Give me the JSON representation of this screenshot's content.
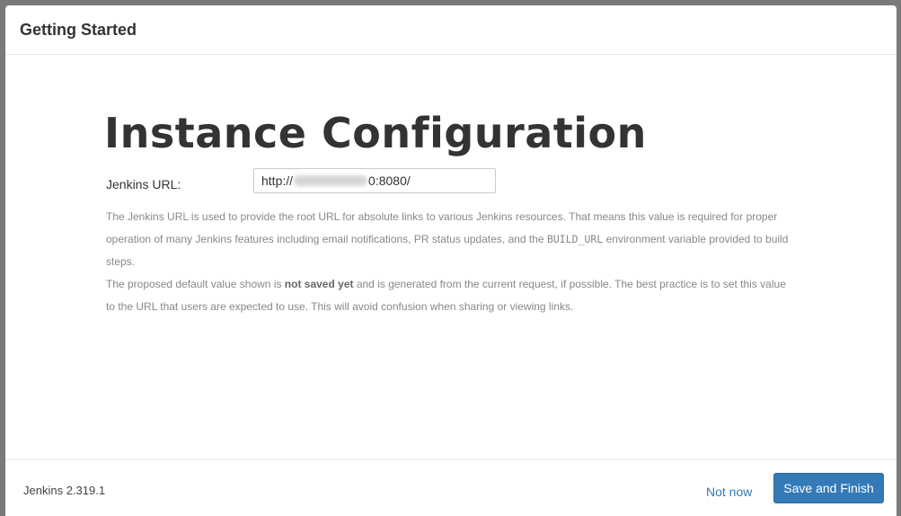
{
  "header": {
    "title": "Getting Started"
  },
  "main": {
    "title": "Instance Configuration",
    "url_label": "Jenkins URL:",
    "url_prefix": "http://",
    "url_suffix": "0:8080/",
    "help_line1": "The Jenkins URL is used to provide the root URL for absolute links to various Jenkins resources. That means this value is required for proper operation of many Jenkins features including email notifications, PR status updates, and the ",
    "help_code": "BUILD_URL",
    "help_line1_end": " environment variable provided to build steps.",
    "help_line2_start": "The proposed default value shown is ",
    "help_bold": "not saved yet",
    "help_line2_end": " and is generated from the current request, if possible. The best practice is to set this value to the URL that users are expected to use. This will avoid confusion when sharing or viewing links."
  },
  "footer": {
    "version": "Jenkins 2.319.1",
    "not_now_label": "Not now",
    "save_label": "Save and Finish"
  },
  "colors": {
    "primary": "#337ab7",
    "overlay": "#7a7a7a"
  }
}
